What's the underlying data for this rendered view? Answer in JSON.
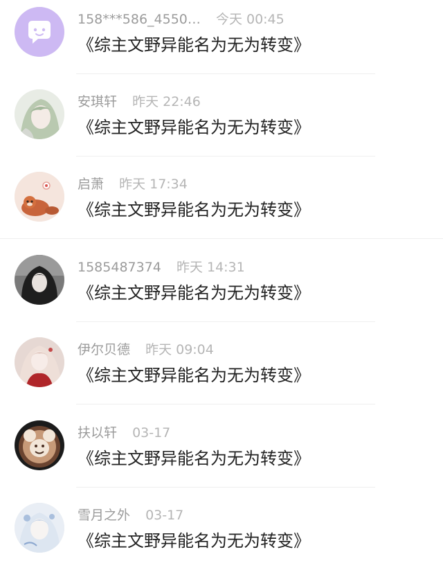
{
  "comments": [
    {
      "name": "158***586_4550…",
      "time": "今天 00:45",
      "text": "《综主文野异能名为无为转变》",
      "avatar_icon": "chat-bubble-face-icon",
      "avatar_color": "#cdb9f3"
    },
    {
      "name": "安琪轩",
      "time": "昨天 22:46",
      "text": "《综主文野异能名为无为转变》",
      "avatar_icon": "anime-green-hair-avatar",
      "avatar_color": "#d6e0cf"
    },
    {
      "name": "启萧",
      "time": "昨天 17:34",
      "text": "《综主文野异能名为无为转变》",
      "avatar_icon": "red-panda-illustration-avatar",
      "avatar_color": "#f3e1d8"
    },
    {
      "name": "1585487374",
      "time": "昨天 14:31",
      "text": "《综主文野异能名为无为转变》",
      "avatar_icon": "dark-hair-portrait-avatar",
      "avatar_color": "#5e5e5e"
    },
    {
      "name": "伊尔贝德",
      "time": "昨天 09:04",
      "text": "《综主文野异能名为无为转变》",
      "avatar_icon": "anime-red-dress-avatar",
      "avatar_color": "#d9c7c2"
    },
    {
      "name": "扶以轩",
      "time": "03-17",
      "text": "《综主文野异能名为无为转变》",
      "avatar_icon": "mickey-latte-art-avatar",
      "avatar_color": "#3b2b24"
    },
    {
      "name": "雪月之外",
      "time": "03-17",
      "text": "《综主文野异能名为无为转变》",
      "avatar_icon": "blue-white-anime-avatar",
      "avatar_color": "#dfe8f3"
    }
  ]
}
